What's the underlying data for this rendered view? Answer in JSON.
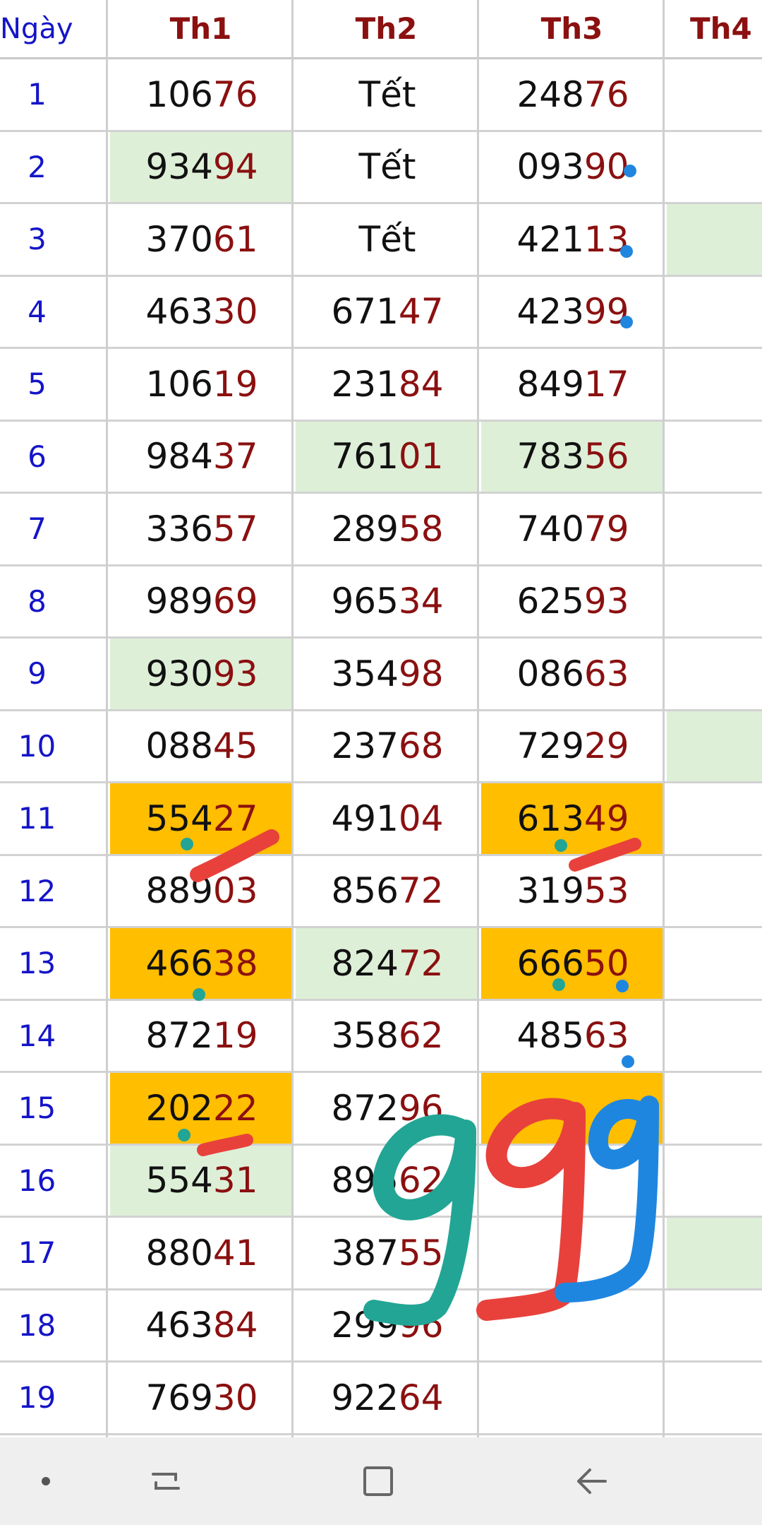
{
  "table": {
    "headers": [
      "Ngày",
      "Th1",
      "Th2",
      "Th3",
      "Th4"
    ],
    "rows": [
      {
        "day": "1",
        "cols": [
          {
            "head": "106",
            "tail": "76"
          },
          {
            "text": "Tết"
          },
          {
            "head": "248",
            "tail": "76"
          },
          {}
        ]
      },
      {
        "day": "2",
        "cols": [
          {
            "head": "934",
            "tail": "94",
            "bg": "green"
          },
          {
            "text": "Tết"
          },
          {
            "head": "093",
            "tail": "90"
          },
          {}
        ]
      },
      {
        "day": "3",
        "cols": [
          {
            "head": "370",
            "tail": "61"
          },
          {
            "text": "Tết"
          },
          {
            "head": "421",
            "tail": "13"
          },
          {
            "bg": "green"
          }
        ]
      },
      {
        "day": "4",
        "cols": [
          {
            "head": "463",
            "tail": "30"
          },
          {
            "head": "671",
            "tail": "47"
          },
          {
            "head": "423",
            "tail": "99"
          },
          {}
        ]
      },
      {
        "day": "5",
        "cols": [
          {
            "head": "106",
            "tail": "19"
          },
          {
            "head": "231",
            "tail": "84"
          },
          {
            "head": "849",
            "tail": "17"
          },
          {}
        ]
      },
      {
        "day": "6",
        "cols": [
          {
            "head": "984",
            "tail": "37"
          },
          {
            "head": "761",
            "tail": "01",
            "bg": "green"
          },
          {
            "head": "783",
            "tail": "56",
            "bg": "green"
          },
          {}
        ]
      },
      {
        "day": "7",
        "cols": [
          {
            "head": "336",
            "tail": "57"
          },
          {
            "head": "289",
            "tail": "58"
          },
          {
            "head": "740",
            "tail": "79"
          },
          {}
        ]
      },
      {
        "day": "8",
        "cols": [
          {
            "head": "989",
            "tail": "69"
          },
          {
            "head": "965",
            "tail": "34"
          },
          {
            "head": "625",
            "tail": "93"
          },
          {}
        ]
      },
      {
        "day": "9",
        "cols": [
          {
            "head": "930",
            "tail": "93",
            "bg": "green"
          },
          {
            "head": "354",
            "tail": "98"
          },
          {
            "head": "086",
            "tail": "63"
          },
          {}
        ]
      },
      {
        "day": "10",
        "cols": [
          {
            "head": "088",
            "tail": "45"
          },
          {
            "head": "237",
            "tail": "68"
          },
          {
            "head": "729",
            "tail": "29"
          },
          {
            "bg": "green"
          }
        ]
      },
      {
        "day": "11",
        "cols": [
          {
            "head": "554",
            "tail": "27",
            "bg": "orange"
          },
          {
            "head": "491",
            "tail": "04"
          },
          {
            "head": "613",
            "tail": "49",
            "bg": "orange"
          },
          {}
        ]
      },
      {
        "day": "12",
        "cols": [
          {
            "head": "889",
            "tail": "03"
          },
          {
            "head": "856",
            "tail": "72"
          },
          {
            "head": "319",
            "tail": "53"
          },
          {}
        ]
      },
      {
        "day": "13",
        "cols": [
          {
            "head": "466",
            "tail": "38",
            "bg": "orange"
          },
          {
            "head": "824",
            "tail": "72",
            "bg": "green"
          },
          {
            "head": "666",
            "tail": "50",
            "bg": "orange"
          },
          {}
        ]
      },
      {
        "day": "14",
        "cols": [
          {
            "head": "872",
            "tail": "19"
          },
          {
            "head": "358",
            "tail": "62"
          },
          {
            "head": "485",
            "tail": "63"
          },
          {}
        ]
      },
      {
        "day": "15",
        "cols": [
          {
            "head": "202",
            "tail": "22",
            "bg": "orange"
          },
          {
            "head": "872",
            "tail": "96"
          },
          {
            "bg": "orange"
          },
          {}
        ]
      },
      {
        "day": "16",
        "cols": [
          {
            "head": "554",
            "tail": "31",
            "bg": "green"
          },
          {
            "head": "895",
            "tail": "62"
          },
          {},
          {}
        ]
      },
      {
        "day": "17",
        "cols": [
          {
            "head": "880",
            "tail": "41"
          },
          {
            "head": "387",
            "tail": "55"
          },
          {},
          {
            "bg": "green"
          }
        ]
      },
      {
        "day": "18",
        "cols": [
          {
            "head": "463",
            "tail": "84"
          },
          {
            "head": "299",
            "tail": "96"
          },
          {},
          {}
        ]
      },
      {
        "day": "19",
        "cols": [
          {
            "head": "769",
            "tail": "30"
          },
          {
            "head": "922",
            "tail": "64"
          },
          {},
          {}
        ]
      }
    ]
  },
  "colors": {
    "green_highlight": "#deefd8",
    "orange_highlight": "#ffbe00",
    "day_text": "#1414c8",
    "tail_text": "#8b1010",
    "scribble_teal": "#22a595",
    "scribble_red": "#e8413c",
    "scribble_blue": "#1f86e0"
  },
  "navbar": {
    "icons": [
      "dot-icon",
      "recent-apps-icon",
      "home-icon",
      "back-icon"
    ]
  }
}
